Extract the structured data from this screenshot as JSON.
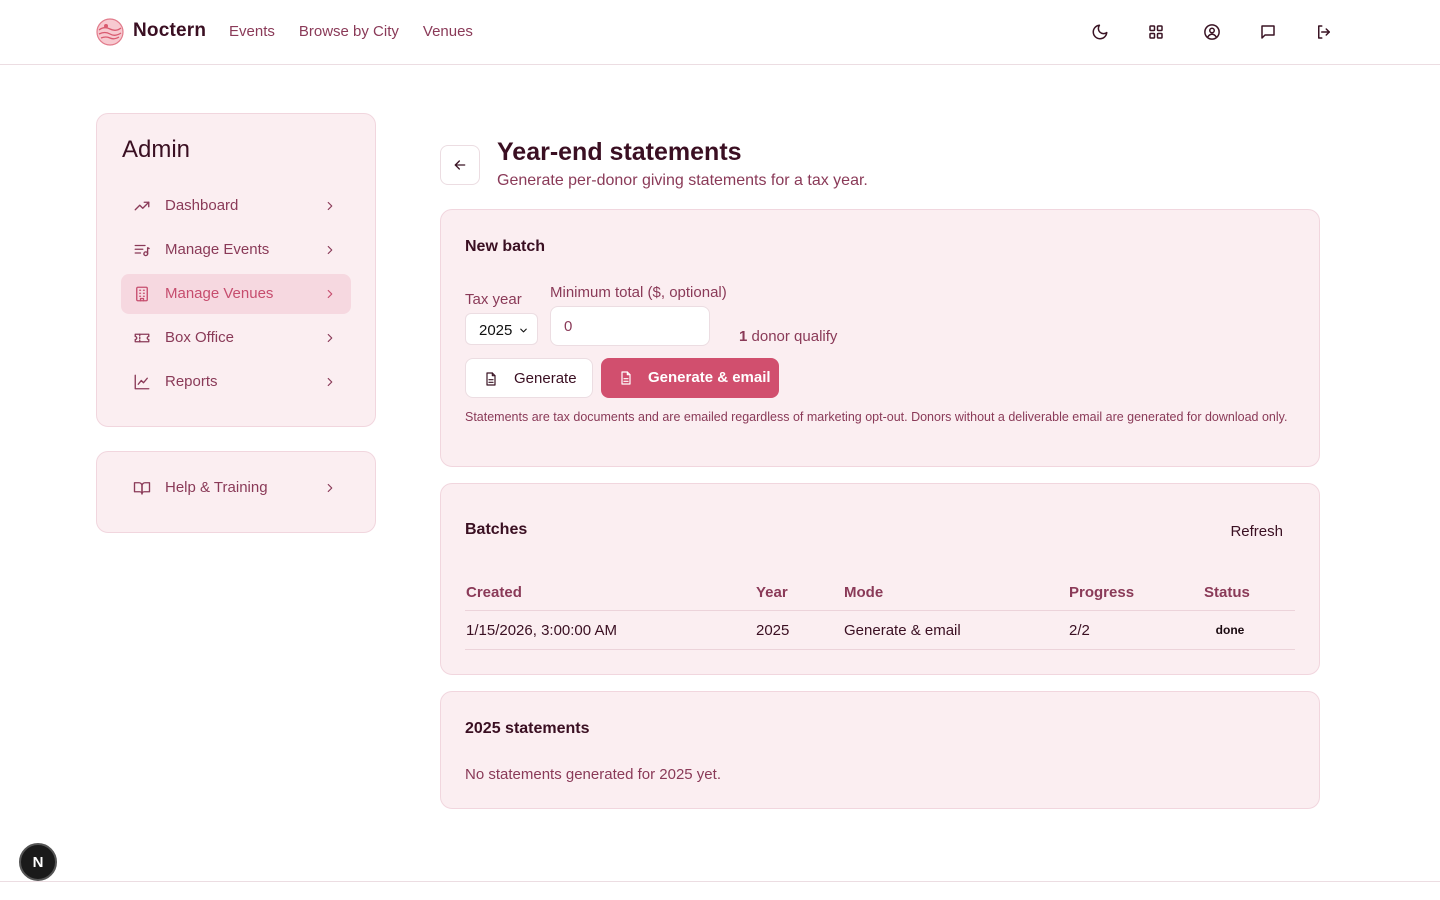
{
  "app": {
    "brand": "Noctern",
    "nav": [
      "Events",
      "Browse by City",
      "Venues"
    ],
    "top_icons": [
      "moon-icon",
      "grid-icon",
      "user-circle-icon",
      "message-icon",
      "logout-icon"
    ]
  },
  "sidebar": {
    "title": "Admin",
    "items": [
      {
        "label": "Dashboard",
        "icon": "trending-up-icon"
      },
      {
        "label": "Manage Events",
        "icon": "list-music-icon"
      },
      {
        "label": "Manage Venues",
        "icon": "building-icon",
        "active": true
      },
      {
        "label": "Box Office",
        "icon": "ticket-icon"
      },
      {
        "label": "Reports",
        "icon": "chart-line-icon"
      }
    ],
    "help": {
      "label": "Help & Training",
      "icon": "book-open-icon"
    }
  },
  "page": {
    "title": "Year-end statements",
    "subtitle": "Generate per-donor giving statements for a tax year."
  },
  "new_batch": {
    "title": "New batch",
    "tax_year_label": "Tax year",
    "tax_year_value": "2025",
    "min_total_label": "Minimum total ($, optional)",
    "min_total_value": "0",
    "qualify_count": "1",
    "qualify_text": "donor qualify",
    "generate_label": "Generate",
    "generate_email_label": "Generate & email",
    "note": "Statements are tax documents and are emailed regardless of marketing opt-out. Donors without a deliverable email are generated for download only."
  },
  "batches": {
    "title": "Batches",
    "refresh_label": "Refresh",
    "columns": [
      "Created",
      "Year",
      "Mode",
      "Progress",
      "Status"
    ],
    "rows": [
      {
        "created": "1/15/2026, 3:00:00 AM",
        "year": "2025",
        "mode": "Generate & email",
        "progress": "2/2",
        "status": "done"
      }
    ]
  },
  "statements": {
    "title": "2025 statements",
    "empty": "No statements generated for 2025 yet."
  },
  "badge": "N",
  "colors": {
    "accent": "#d14f6e",
    "card_bg": "#fbeef1",
    "muted_text": "#8a3a58"
  }
}
